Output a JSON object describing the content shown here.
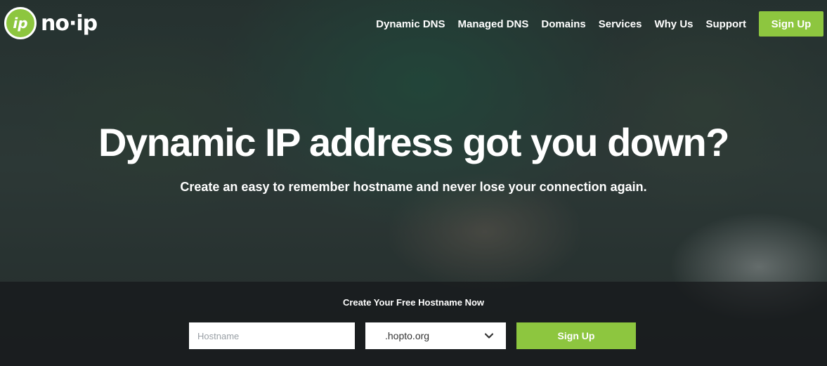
{
  "colors": {
    "brand_green": "#8dc63f",
    "text": "#ffffff"
  },
  "logo": {
    "badge_text": "ip",
    "wordmark": "no·ip",
    "icon": "noip-logo-icon"
  },
  "nav": {
    "items": [
      "Dynamic DNS",
      "Managed DNS",
      "Domains",
      "Services",
      "Why Us",
      "Support"
    ],
    "signup_label": "Sign Up"
  },
  "hero": {
    "headline": "Dynamic IP address got you down?",
    "subheadline": "Create an easy to remember hostname and never lose your connection again."
  },
  "signup_form": {
    "title": "Create Your Free Hostname Now",
    "hostname_placeholder": "Hostname",
    "hostname_value": "",
    "domain_selected": ".hopto.org",
    "dropdown_icon": "chevron-down-icon",
    "submit_label": "Sign Up"
  }
}
